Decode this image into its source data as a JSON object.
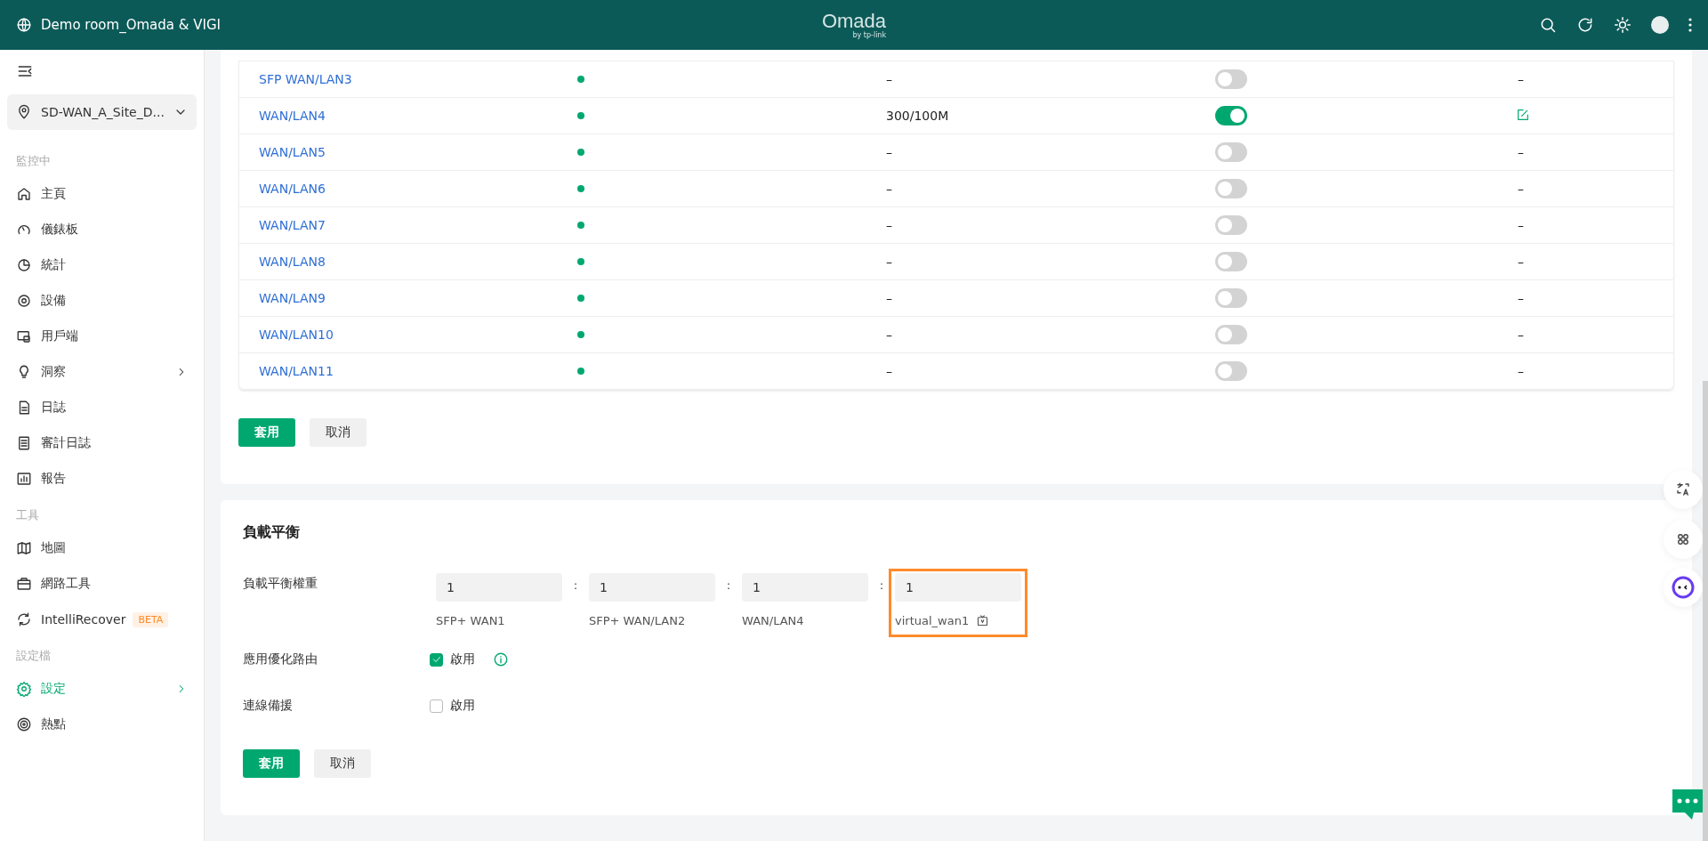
{
  "header": {
    "title": "Demo room_Omada & VIGI",
    "logo": "Omada",
    "logo_sub": "by tp-link"
  },
  "sidebar": {
    "site": "SD-WAN_A_Site_D...",
    "sections": [
      {
        "heading": "監控中",
        "items": [
          {
            "label": "主頁",
            "selected": false,
            "expandable": false
          },
          {
            "label": "儀錶板",
            "selected": false,
            "expandable": false
          },
          {
            "label": "統計",
            "selected": false,
            "expandable": false
          },
          {
            "label": "設備",
            "selected": false,
            "expandable": false
          },
          {
            "label": "用戶端",
            "selected": false,
            "expandable": false
          },
          {
            "label": "洞察",
            "selected": false,
            "expandable": true
          },
          {
            "label": "日誌",
            "selected": false,
            "expandable": false
          },
          {
            "label": "審計日誌",
            "selected": false,
            "expandable": false
          },
          {
            "label": "報告",
            "selected": false,
            "expandable": false
          }
        ]
      },
      {
        "heading": "工具",
        "items": [
          {
            "label": "地圖",
            "selected": false,
            "expandable": false
          },
          {
            "label": "網路工具",
            "selected": false,
            "expandable": false
          },
          {
            "label": "IntelliRecover",
            "selected": false,
            "expandable": false,
            "badge": "BETA"
          }
        ]
      },
      {
        "heading": "設定檔",
        "items": [
          {
            "label": "設定",
            "selected": true,
            "expandable": true
          },
          {
            "label": "熱點",
            "selected": false,
            "expandable": false
          }
        ]
      }
    ]
  },
  "ports_table": {
    "rows": [
      {
        "name": "SFP WAN/LAN3",
        "online": true,
        "bandwidth": "–",
        "enabled": false,
        "editable": false,
        "action": "–"
      },
      {
        "name": "WAN/LAN4",
        "online": true,
        "bandwidth": "300/100M",
        "enabled": true,
        "editable": true
      },
      {
        "name": "WAN/LAN5",
        "online": true,
        "bandwidth": "–",
        "enabled": false,
        "editable": false,
        "action": "–"
      },
      {
        "name": "WAN/LAN6",
        "online": true,
        "bandwidth": "–",
        "enabled": false,
        "editable": false,
        "action": "–"
      },
      {
        "name": "WAN/LAN7",
        "online": true,
        "bandwidth": "–",
        "enabled": false,
        "editable": false,
        "action": "–"
      },
      {
        "name": "WAN/LAN8",
        "online": true,
        "bandwidth": "–",
        "enabled": false,
        "editable": false,
        "action": "–"
      },
      {
        "name": "WAN/LAN9",
        "online": true,
        "bandwidth": "–",
        "enabled": false,
        "editable": false,
        "action": "–"
      },
      {
        "name": "WAN/LAN10",
        "online": true,
        "bandwidth": "–",
        "enabled": false,
        "editable": false,
        "action": "–"
      },
      {
        "name": "WAN/LAN11",
        "online": true,
        "bandwidth": "–",
        "enabled": false,
        "editable": false,
        "action": "–"
      }
    ],
    "buttons": [
      "套用",
      "取消"
    ]
  },
  "load_balance": {
    "title": "負載平衡",
    "weight_label": "負載平衡權重",
    "weights": [
      {
        "value": "1",
        "name": "SFP+ WAN1",
        "highlighted": false,
        "virtual": false
      },
      {
        "separator": ":",
        "value": "1",
        "name": "SFP+ WAN/LAN2",
        "highlighted": false,
        "virtual": false
      },
      {
        "separator": ":",
        "value": "1",
        "name": "WAN/LAN4",
        "highlighted": false,
        "virtual": false
      },
      {
        "separator": ":",
        "value": "1",
        "name": "virtual_wan1",
        "highlighted": true,
        "virtual": true
      }
    ],
    "options": [
      {
        "label": "應用優化路由",
        "checkbox_label": "啟用",
        "checked": true,
        "info": true
      },
      {
        "label": "連線備援",
        "checkbox_label": "啟用",
        "checked": false,
        "info": false
      }
    ],
    "buttons": [
      "套用",
      "取消"
    ]
  }
}
